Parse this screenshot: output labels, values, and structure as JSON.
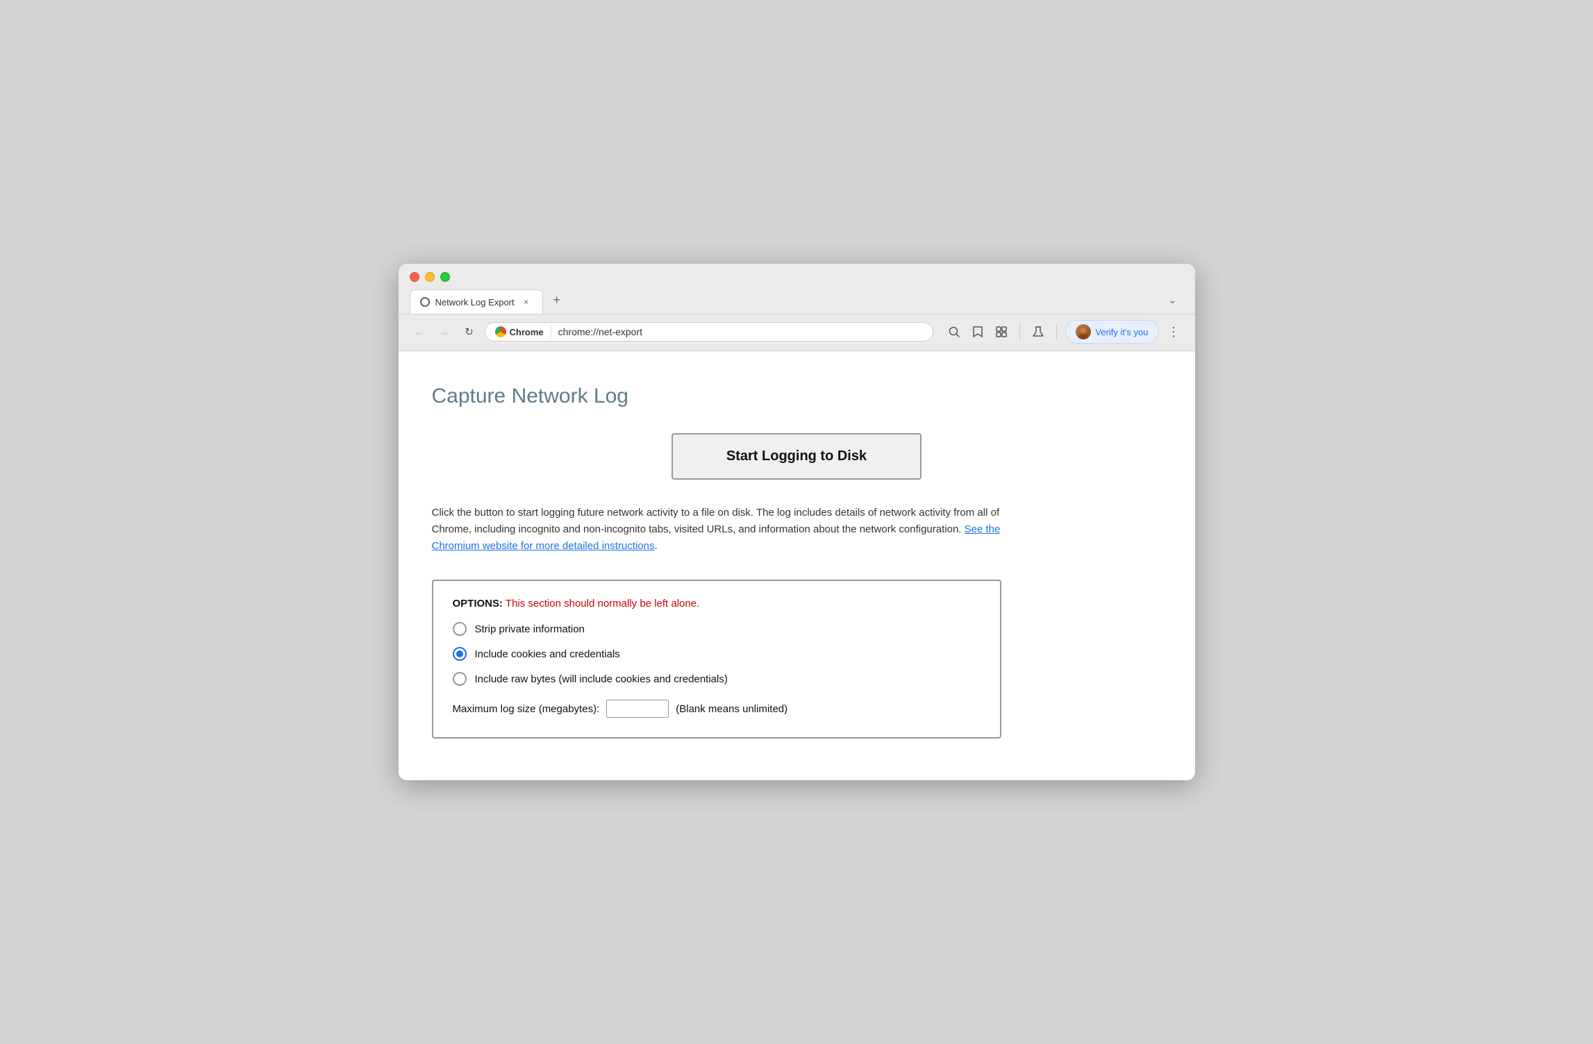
{
  "browser": {
    "tab_title": "Network Log Export",
    "tab_close_label": "×",
    "tab_new_label": "+",
    "tab_expand_label": "⌄",
    "nav_back": "←",
    "nav_forward": "→",
    "nav_refresh": "↻",
    "chrome_badge": "Chrome",
    "url": "chrome://net-export",
    "search_icon": "🔍",
    "star_icon": "☆",
    "extension_icon": "□",
    "beaker_icon": "⚗",
    "verify_label": "Verify it's you",
    "menu_icon": "⋮"
  },
  "page": {
    "title": "Capture Network Log",
    "start_button": "Start Logging to Disk",
    "description_text": "Click the button to start logging future network activity to a file on disk. The log includes details of network activity from all of Chrome, including incognito and non-incognito tabs, visited URLs, and information about the network configuration.",
    "link_text": "See the Chromium website for more detailed instructions",
    "link_suffix": ".",
    "options": {
      "header_label": "OPTIONS:",
      "warning_text": " This section should normally be left alone.",
      "radio_items": [
        {
          "id": "strip",
          "label": "Strip private information",
          "selected": false
        },
        {
          "id": "cookies",
          "label": "Include cookies and credentials",
          "selected": true
        },
        {
          "id": "raw",
          "label": "Include raw bytes (will include cookies and credentials)",
          "selected": false
        }
      ],
      "max_log_label": "Maximum log size (megabytes):",
      "max_log_suffix": "(Blank means unlimited)",
      "max_log_value": ""
    }
  }
}
